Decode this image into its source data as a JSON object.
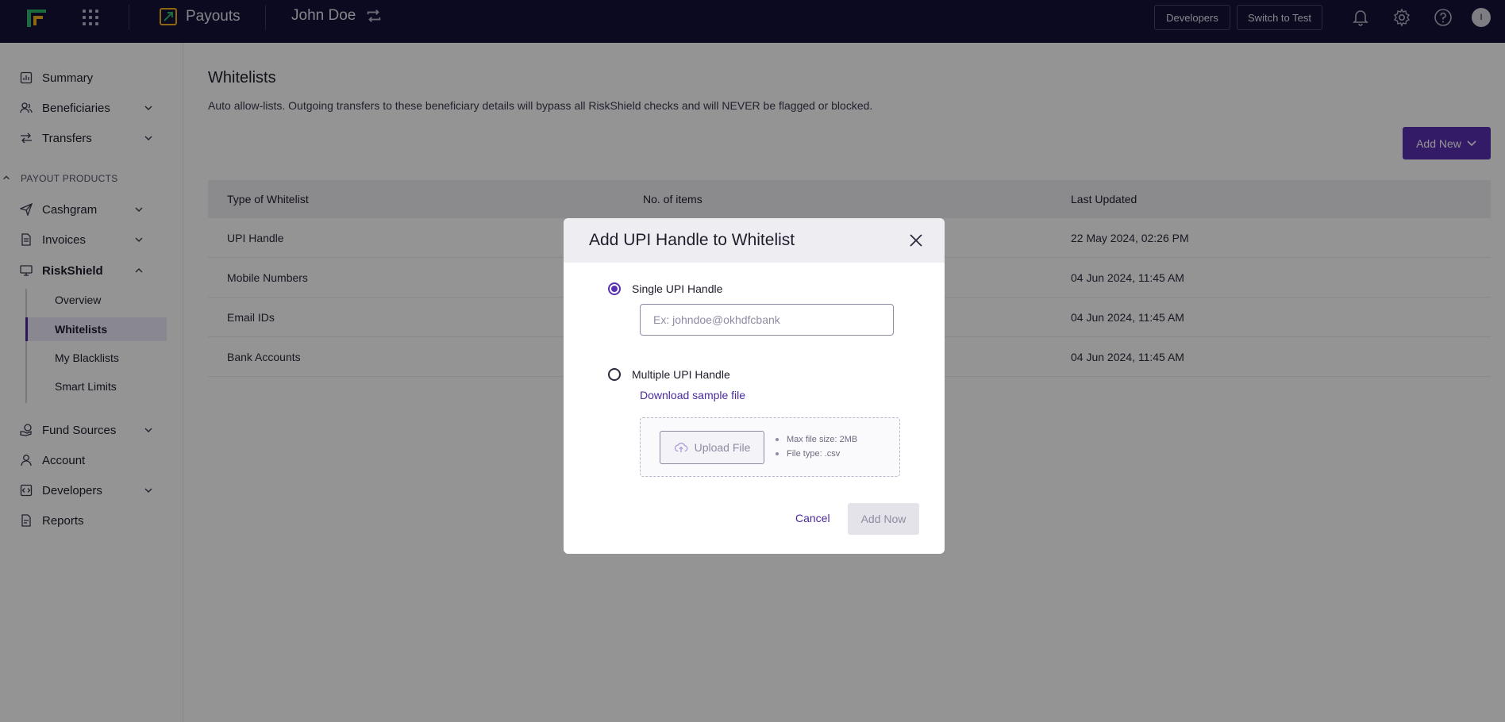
{
  "topbar": {
    "product_name": "Payouts",
    "account_name": "John Doe",
    "developers_button": "Developers",
    "switch_button": "Switch to Test",
    "avatar_initial": "I"
  },
  "sidebar": {
    "summary": "Summary",
    "beneficiaries": "Beneficiaries",
    "transfers": "Transfers",
    "section_label": "PAYOUT PRODUCTS",
    "cashgram": "Cashgram",
    "invoices": "Invoices",
    "riskshield": "RiskShield",
    "sub_items": [
      "Overview",
      "Whitelists",
      "My Blacklists",
      "Smart Limits"
    ],
    "fund_sources": "Fund Sources",
    "account": "Account",
    "developers": "Developers",
    "reports": "Reports"
  },
  "main": {
    "title": "Whitelists",
    "description": "Auto allow-lists. Outgoing transfers to these beneficiary details will bypass all RiskShield checks and will NEVER be flagged or blocked.",
    "add_new_label": "Add New",
    "table": {
      "headers": [
        "Type of Whitelist",
        "No. of items",
        "Last Updated"
      ],
      "rows": [
        {
          "type": "UPI Handle",
          "updated": "22 May 2024, 02:26 PM"
        },
        {
          "type": "Mobile Numbers",
          "updated": "04 Jun 2024, 11:45 AM"
        },
        {
          "type": "Email IDs",
          "updated": "04 Jun 2024, 11:45 AM"
        },
        {
          "type": "Bank Accounts",
          "updated": "04 Jun 2024, 11:45 AM"
        }
      ]
    }
  },
  "modal": {
    "title": "Add UPI Handle to Whitelist",
    "single_label": "Single UPI Handle",
    "input_placeholder": "Ex: johndoe@okhdfcbank",
    "multiple_label": "Multiple UPI Handle",
    "download_link": "Download sample file",
    "upload_label": "Upload File",
    "requirements": [
      "Max file size: 2MB",
      "File type: .csv"
    ],
    "cancel_label": "Cancel",
    "add_now_label": "Add Now"
  },
  "colors": {
    "topbar_bg": "#141237",
    "accent": "#5a2fb2",
    "link": "#4b2a9e"
  }
}
